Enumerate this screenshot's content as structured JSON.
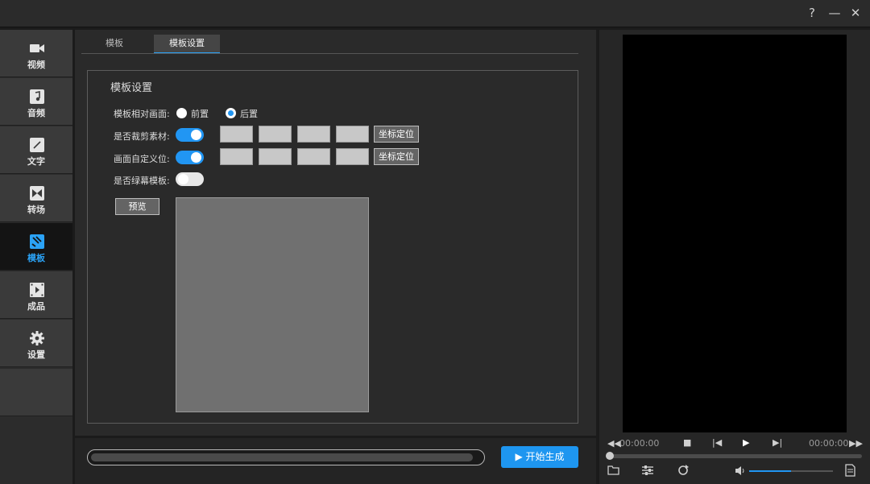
{
  "window": {
    "help_label": "?",
    "minimize_label": "—",
    "close_label": "✕"
  },
  "sidebar": {
    "items": [
      {
        "label": "视频",
        "icon": "video-camera-icon"
      },
      {
        "label": "音频",
        "icon": "music-note-icon"
      },
      {
        "label": "文字",
        "icon": "text-pen-icon"
      },
      {
        "label": "转场",
        "icon": "transition-icon"
      },
      {
        "label": "模板",
        "icon": "template-icon",
        "active": true
      },
      {
        "label": "成品",
        "icon": "film-reel-icon"
      },
      {
        "label": "设置",
        "icon": "gear-icon"
      }
    ]
  },
  "tabs": [
    {
      "label": "模板",
      "active": false
    },
    {
      "label": "模板设置",
      "active": true
    }
  ],
  "panel": {
    "title": "模板设置",
    "position_label": "模板相对画面:",
    "position_options": [
      {
        "label": "前置",
        "selected": false
      },
      {
        "label": "后置",
        "selected": true
      }
    ],
    "crop_label": "是否裁剪素材:",
    "crop_enabled": true,
    "crop_locate_label": "坐标定位",
    "custom_pos_label": "画面自定义位:",
    "custom_pos_enabled": true,
    "custom_pos_locate_label": "坐标定位",
    "greenscreen_label": "是否绿幕模板:",
    "greenscreen_enabled": false,
    "preview_label": "预览"
  },
  "bottom": {
    "progress_fraction": 0.98,
    "start_label": "▶ 开始生成"
  },
  "player": {
    "current_time": "00:00:00",
    "total_time": "00:00:00",
    "volume_fraction": 0.5
  },
  "colors": {
    "accent": "#2196f3",
    "active_tab_text": "#2ba2f5",
    "start_button": "#1e96f0"
  }
}
